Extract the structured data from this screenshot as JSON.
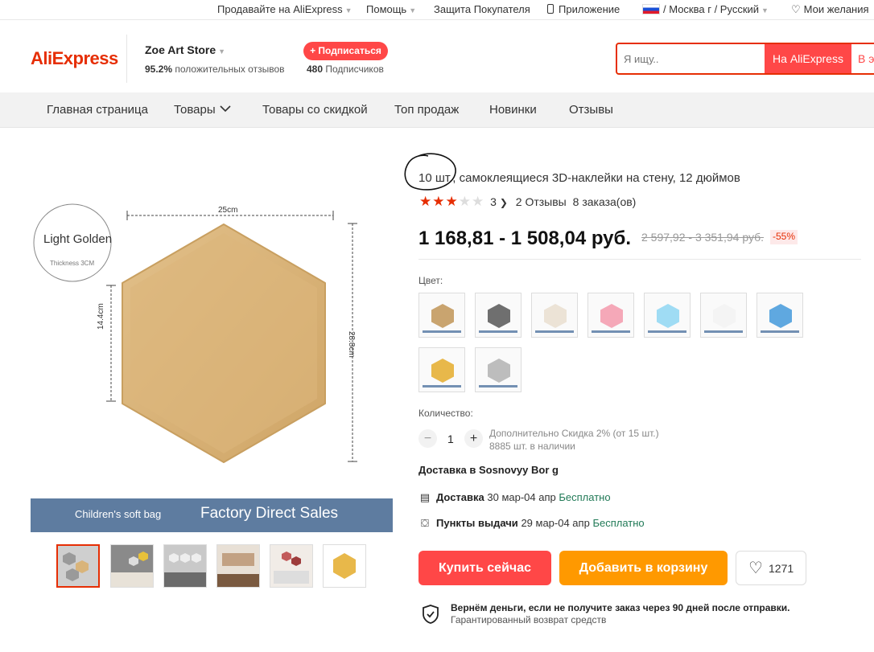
{
  "topbar": {
    "sell": "Продавайте на AliExpress",
    "help": "Помощь",
    "protection": "Защита Покупателя",
    "app": "Приложение",
    "region": "/ Москва г / Русский",
    "wishlist": "Мои желания"
  },
  "header": {
    "logo": "AliExpress",
    "store_name": "Zoe Art Store",
    "feedback_pct": "95.2%",
    "feedback_label": "положительных отзывов",
    "subscribe": "+ Подписаться",
    "subscribers_count": "480",
    "subscribers_label": "Подписчиков",
    "search_placeholder": "Я ищу..",
    "search_btn": "На AliExpress",
    "search_btn2": "В э"
  },
  "nav": [
    "Главная страница",
    "Товары",
    "Товары со скидкой",
    "Топ продаж",
    "Новинки",
    "Отзывы"
  ],
  "image": {
    "color_label": "Light Golden",
    "thickness": "Thickness 3CM",
    "width_dim": "25cm",
    "side_dim": "14.4cm",
    "height_dim": "28.8cm",
    "banner_left": "Children's soft bag",
    "banner_right": "Factory Direct Sales",
    "hex_color": "#d9b47a"
  },
  "product": {
    "title_highlight": "10 шт.,",
    "title_rest": " самоклеящиеся 3D-наклейки на стену, 12 дюймов",
    "rating_value": 3,
    "rating_text": "3",
    "reviews": "2 Отзывы",
    "orders": "8 заказа(ов)",
    "price": "1 168,81 - 1 508,04 руб.",
    "old_price": "2 597,92 - 3 351,94 руб.",
    "discount": "-55%",
    "color_label": "Цвет:",
    "swatches": [
      "#c9a46f",
      "#6f6f6f",
      "#ece3d6",
      "#f5a8b8",
      "#9fdcf4",
      "#f4f4f4",
      "#5fa8e0",
      "#e8b84a",
      "#bdbdbd"
    ],
    "qty_label": "Количество:",
    "qty_value": "1",
    "qty_minus": "−",
    "qty_plus": "+",
    "qty_discount": "Дополнительно Скидка 2% (от 15 шт.)",
    "qty_stock": "8885 шт. в наличии",
    "delivery_to": "Доставка в Sosnovyy Bor g",
    "delivery_label": "Доставка",
    "delivery_dates": "30 мар-04 апр",
    "delivery_price": "Бесплатно",
    "pickup_label": "Пункты выдачи",
    "pickup_dates": "29 мар-04 апр",
    "pickup_price": "Бесплатно",
    "buy_now": "Купить сейчас",
    "add_to_cart": "Добавить в корзину",
    "wish_count": "1271",
    "guarantee_title": "Вернём деньги, если не получите заказ через 90 дней после отправки.",
    "guarantee_sub": "Гарантированный возврат средств"
  }
}
